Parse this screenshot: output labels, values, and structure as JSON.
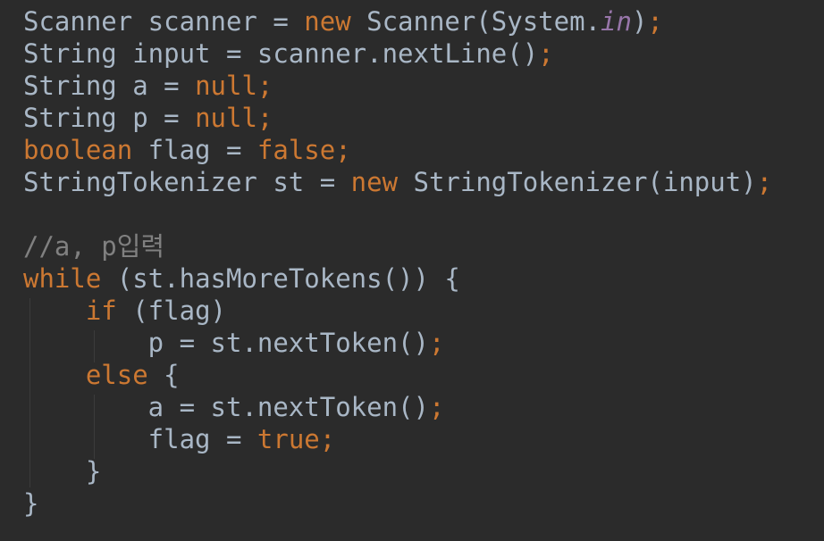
{
  "editor": {
    "theme_colors": {
      "background": "#2b2b2b",
      "plain": "#a9b7c6",
      "keyword": "#cc7832",
      "static_field": "#9876aa",
      "comment": "#808080"
    },
    "lines": [
      {
        "tokens": [
          {
            "t": "Scanner scanner = ",
            "k": "plain"
          },
          {
            "t": "new",
            "k": "kw"
          },
          {
            "t": " Scanner(System.",
            "k": "plain"
          },
          {
            "t": "in",
            "k": "static"
          },
          {
            "t": ")",
            "k": "plain"
          },
          {
            "t": ";",
            "k": "kw"
          }
        ]
      },
      {
        "tokens": [
          {
            "t": "String input = scanner.nextLine()",
            "k": "plain"
          },
          {
            "t": ";",
            "k": "kw"
          }
        ]
      },
      {
        "tokens": [
          {
            "t": "String a = ",
            "k": "plain"
          },
          {
            "t": "null;",
            "k": "kw"
          }
        ]
      },
      {
        "tokens": [
          {
            "t": "String p = ",
            "k": "plain"
          },
          {
            "t": "null;",
            "k": "kw"
          }
        ]
      },
      {
        "tokens": [
          {
            "t": "boolean",
            "k": "kw"
          },
          {
            "t": " flag = ",
            "k": "plain"
          },
          {
            "t": "false;",
            "k": "kw"
          }
        ]
      },
      {
        "tokens": [
          {
            "t": "StringTokenizer st = ",
            "k": "plain"
          },
          {
            "t": "new",
            "k": "kw"
          },
          {
            "t": " StringTokenizer(input)",
            "k": "plain"
          },
          {
            "t": ";",
            "k": "kw"
          }
        ]
      },
      {
        "tokens": []
      },
      {
        "tokens": [
          {
            "t": "//a, p입력",
            "k": "comment"
          }
        ]
      },
      {
        "tokens": [
          {
            "t": "while",
            "k": "kw"
          },
          {
            "t": " (st.hasMoreTokens()) {",
            "k": "plain"
          }
        ]
      },
      {
        "tokens": [
          {
            "t": "    ",
            "k": "plain"
          },
          {
            "t": "if",
            "k": "kw"
          },
          {
            "t": " (flag)",
            "k": "plain"
          }
        ]
      },
      {
        "tokens": [
          {
            "t": "        p = st.nextToken()",
            "k": "plain"
          },
          {
            "t": ";",
            "k": "kw"
          }
        ]
      },
      {
        "tokens": [
          {
            "t": "    ",
            "k": "plain"
          },
          {
            "t": "else",
            "k": "kw"
          },
          {
            "t": " {",
            "k": "plain"
          }
        ]
      },
      {
        "tokens": [
          {
            "t": "        a = st.nextToken()",
            "k": "plain"
          },
          {
            "t": ";",
            "k": "kw"
          }
        ]
      },
      {
        "tokens": [
          {
            "t": "        flag = ",
            "k": "plain"
          },
          {
            "t": "true;",
            "k": "kw"
          }
        ]
      },
      {
        "tokens": [
          {
            "t": "    }",
            "k": "plain"
          }
        ]
      },
      {
        "tokens": [
          {
            "t": "}",
            "k": "plain"
          }
        ]
      }
    ]
  }
}
